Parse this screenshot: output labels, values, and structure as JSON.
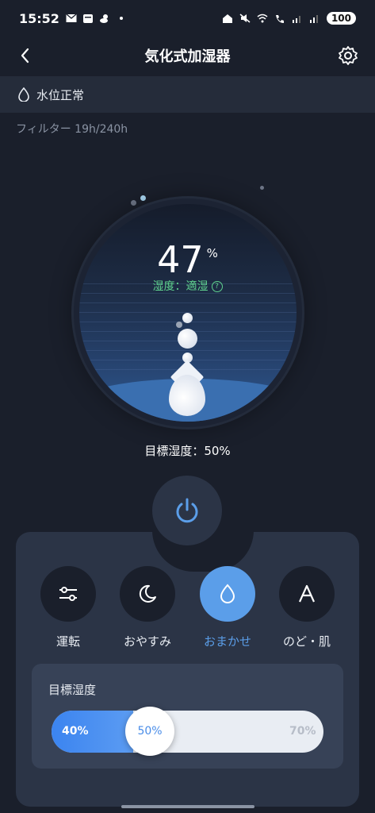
{
  "status_bar": {
    "time": "15:52",
    "battery": "100"
  },
  "header": {
    "title": "気化式加湿器"
  },
  "water_status": {
    "label": "水位正常"
  },
  "filter": {
    "text": "フィルター 19h/240h"
  },
  "humidity": {
    "value": "47",
    "unit": "%",
    "status": "湿度：適湿"
  },
  "target": {
    "text": "目標湿度：50%"
  },
  "modes": [
    {
      "label": "運転",
      "icon": "sliders-icon"
    },
    {
      "label": "おやすみ",
      "icon": "moon-icon"
    },
    {
      "label": "おまかせ",
      "icon": "drop-icon",
      "active": true
    },
    {
      "label": "のど・肌",
      "icon": "letter-a-icon"
    }
  ],
  "slider": {
    "title": "目標湿度",
    "min_label": "40%",
    "max_label": "70%",
    "current_label": "50%",
    "min": 40,
    "max": 70,
    "value": 50
  },
  "colors": {
    "background": "#1a1f2b",
    "accent": "#5b9ee9",
    "status_ok": "#5fd28e"
  }
}
